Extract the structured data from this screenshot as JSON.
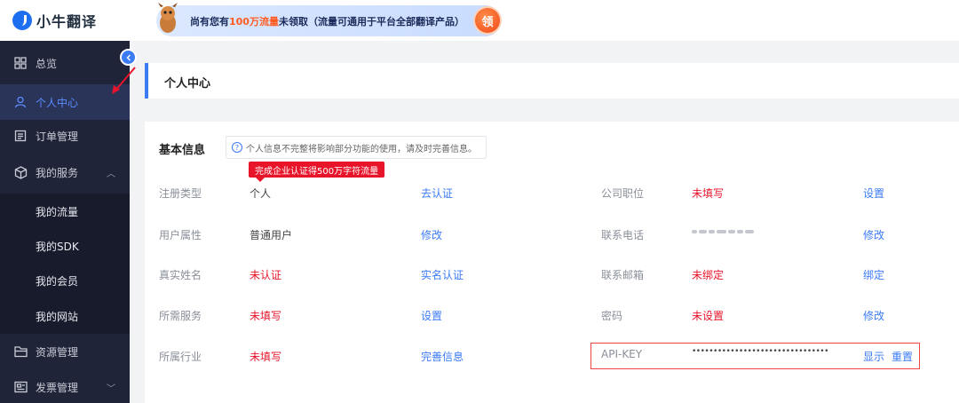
{
  "app": {
    "name": "小牛翻译"
  },
  "banner": {
    "text_before": "尚有您有",
    "text_highlight": "100万流量",
    "text_after": "未领取（流量可通用于平台全部翻译产品）",
    "button_label": "领"
  },
  "sidebar": {
    "items": [
      {
        "label": "总览",
        "icon": "grid-icon"
      },
      {
        "label": "个人中心",
        "icon": "user-icon"
      },
      {
        "label": "订单管理",
        "icon": "order-icon"
      },
      {
        "label": "我的服务",
        "icon": "cube-icon"
      },
      {
        "label": "资源管理",
        "icon": "folder-icon"
      },
      {
        "label": "发票管理",
        "icon": "invoice-icon"
      }
    ],
    "sub_items": [
      "我的流量",
      "我的SDK",
      "我的会员",
      "我的网站"
    ]
  },
  "page": {
    "title": "个人中心"
  },
  "basic_info": {
    "title": "基本信息",
    "tip": "个人信息不完整将影响部分功能的使用，请及时完善信息。",
    "badge": "完成企业认证得500万字符流量",
    "left_rows": [
      {
        "label": "注册类型",
        "value": "个人",
        "action": "去认证"
      },
      {
        "label": "用户属性",
        "value": "普通用户",
        "action": "修改"
      },
      {
        "label": "真实姓名",
        "value": "未认证",
        "action": "实名认证"
      },
      {
        "label": "所需服务",
        "value": "未填写",
        "action": "设置"
      },
      {
        "label": "所属行业",
        "value": "未填写",
        "action": "完善信息"
      }
    ],
    "right_rows": [
      {
        "label": "公司职位",
        "value": "未填写",
        "action": "设置"
      },
      {
        "label": "联系电话",
        "value": "",
        "action": "修改"
      },
      {
        "label": "联系邮箱",
        "value": "未绑定",
        "action": "绑定"
      },
      {
        "label": "密码",
        "value": "未设置",
        "action": "修改"
      },
      {
        "label": "API-KEY",
        "value": "••••••••••••••••••••••••••••••••",
        "action": "显示",
        "action2": "重置"
      }
    ]
  },
  "colors": {
    "accent": "#3c7bf6",
    "warning": "#e8142a",
    "sidebar_bg": "#1f2438"
  }
}
